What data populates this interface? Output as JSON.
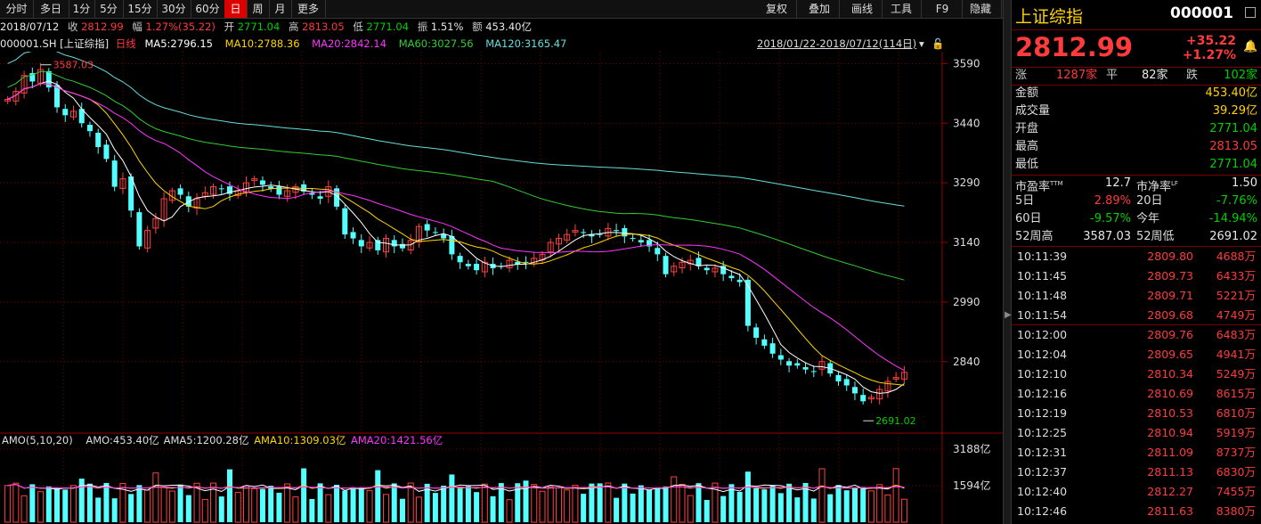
{
  "toolbar": {
    "items": [
      "分时",
      "多日",
      "1分",
      "5分",
      "15分",
      "30分",
      "60分",
      "日",
      "周",
      "月",
      "更多"
    ],
    "active_index": 7,
    "right_items": [
      "复权",
      "叠加",
      "画线",
      "工具",
      "F9",
      "隐藏"
    ]
  },
  "infobar": {
    "date": "2018/07/12",
    "close_label": "收",
    "close_value": "2812.99",
    "change_label": "幅",
    "change_value": "1.27%(35.22)",
    "open_label": "开",
    "open_value": "2771.04",
    "high_label": "高",
    "high_value": "2813.05",
    "low_label": "低",
    "low_value": "2771.04",
    "amp_label": "振",
    "amp_value": "1.51%",
    "amount_label": "额",
    "amount_value": "453.40亿"
  },
  "mabar": {
    "code": "000001.SH [上证综指]",
    "period": "日线",
    "ma5": "MA5:2796.15",
    "ma10": "MA10:2788.36",
    "ma20": "MA20:2842.14",
    "ma60": "MA60:3027.56",
    "ma120": "MA120:3165.47",
    "range": "2018/01/22-2018/07/12(114日)"
  },
  "chart_data": {
    "type": "candlestick",
    "price_axis_ticks": [
      "3590",
      "3440",
      "3290",
      "3140",
      "2990",
      "2840"
    ],
    "volume_axis_ticks": [
      "3188亿",
      "1594亿"
    ],
    "ylim": [
      2660,
      3620
    ],
    "high_annotation": "3587.03",
    "low_annotation": "2691.02",
    "volume_bar": {
      "label": "AMO(5,10,20)",
      "amo": "AMO:453.40亿",
      "ama5": "AMA5:1200.28亿",
      "ama10": "AMA10:1309.03亿",
      "ama20": "AMA20:1421.56亿"
    },
    "close_series": [
      3500,
      3520,
      3560,
      3545,
      3575,
      3530,
      3480,
      3460,
      3470,
      3440,
      3420,
      3380,
      3350,
      3280,
      3300,
      3220,
      3130,
      3170,
      3200,
      3250,
      3270,
      3260,
      3230,
      3250,
      3265,
      3280,
      3275,
      3262,
      3270,
      3290,
      3300,
      3285,
      3275,
      3260,
      3270,
      3280,
      3268,
      3260,
      3250,
      3280,
      3230,
      3160,
      3150,
      3130,
      3140,
      3120,
      3150,
      3130,
      3125,
      3145,
      3180,
      3170,
      3165,
      3150,
      3110,
      3090,
      3080,
      3070,
      3090,
      3075,
      3080,
      3095,
      3085,
      3090,
      3100,
      3110,
      3140,
      3150,
      3160,
      3170,
      3165,
      3155,
      3160,
      3175,
      3170,
      3155,
      3150,
      3140,
      3130,
      3110,
      3060,
      3080,
      3090,
      3095,
      3080,
      3070,
      3075,
      3060,
      3050,
      3040,
      2930,
      2900,
      2880,
      2860,
      2845,
      2830,
      2830,
      2820,
      2815,
      2840,
      2810,
      2790,
      2780,
      2760,
      2740,
      2750,
      2770,
      2790,
      2800,
      2812.99
    ]
  },
  "right": {
    "name": "上证综指",
    "code": "000001",
    "price": "2812.99",
    "change": "+35.22",
    "change_pct": "+1.27%",
    "breadth": {
      "up_label": "涨",
      "up": "1287家",
      "flat_label": "平",
      "flat": "82家",
      "down_label": "跌",
      "down": "102家"
    },
    "stats": [
      {
        "label": "金额",
        "value": "453.40亿",
        "color": "#ffd400"
      },
      {
        "label": "成交量",
        "value": "39.29亿",
        "color": "#ffd400"
      },
      {
        "label": "开盘",
        "value": "2771.04",
        "color": "#00d000"
      },
      {
        "label": "最高",
        "value": "2813.05",
        "color": "#ff3b3b"
      },
      {
        "label": "最低",
        "value": "2771.04",
        "color": "#00d000"
      }
    ],
    "ratios": [
      {
        "l1": "市盈率",
        "s1": "TTM",
        "v1": "12.7",
        "c1": "#e8e8e8",
        "l2": "市净率",
        "s2": "LF",
        "v2": "1.50",
        "c2": "#e8e8e8"
      },
      {
        "l1": "5日",
        "s1": "",
        "v1": "2.89%",
        "c1": "#ff3b3b",
        "l2": "20日",
        "s2": "",
        "v2": "-7.76%",
        "c2": "#00d000"
      },
      {
        "l1": "60日",
        "s1": "",
        "v1": "-9.57%",
        "c1": "#00d000",
        "l2": "今年",
        "s2": "",
        "v2": "-14.94%",
        "c2": "#00d000"
      },
      {
        "l1": "52周高",
        "s1": "",
        "v1": "3587.03",
        "c1": "#e8e8e8",
        "l2": "52周低",
        "s2": "",
        "v2": "2691.02",
        "c2": "#e8e8e8"
      }
    ],
    "ticks": [
      {
        "time": "10:11:39",
        "price": "2809.80",
        "vol": "4688万"
      },
      {
        "time": "10:11:45",
        "price": "2809.73",
        "vol": "6433万"
      },
      {
        "time": "10:11:48",
        "price": "2809.71",
        "vol": "5221万"
      },
      {
        "time": "10:11:54",
        "price": "2809.68",
        "vol": "4749万"
      },
      {
        "time": "10:12:00",
        "price": "2809.76",
        "vol": "6483万"
      },
      {
        "time": "10:12:04",
        "price": "2809.65",
        "vol": "4941万"
      },
      {
        "time": "10:12:10",
        "price": "2810.34",
        "vol": "5249万"
      },
      {
        "time": "10:12:16",
        "price": "2810.69",
        "vol": "8615万"
      },
      {
        "time": "10:12:19",
        "price": "2810.53",
        "vol": "6810万"
      },
      {
        "time": "10:12:25",
        "price": "2810.94",
        "vol": "5919万"
      },
      {
        "time": "10:12:31",
        "price": "2811.09",
        "vol": "8737万"
      },
      {
        "time": "10:12:37",
        "price": "2811.13",
        "vol": "6830万"
      },
      {
        "time": "10:12:40",
        "price": "2812.27",
        "vol": "7455万"
      },
      {
        "time": "10:12:46",
        "price": "2811.63",
        "vol": "8380万"
      }
    ]
  }
}
